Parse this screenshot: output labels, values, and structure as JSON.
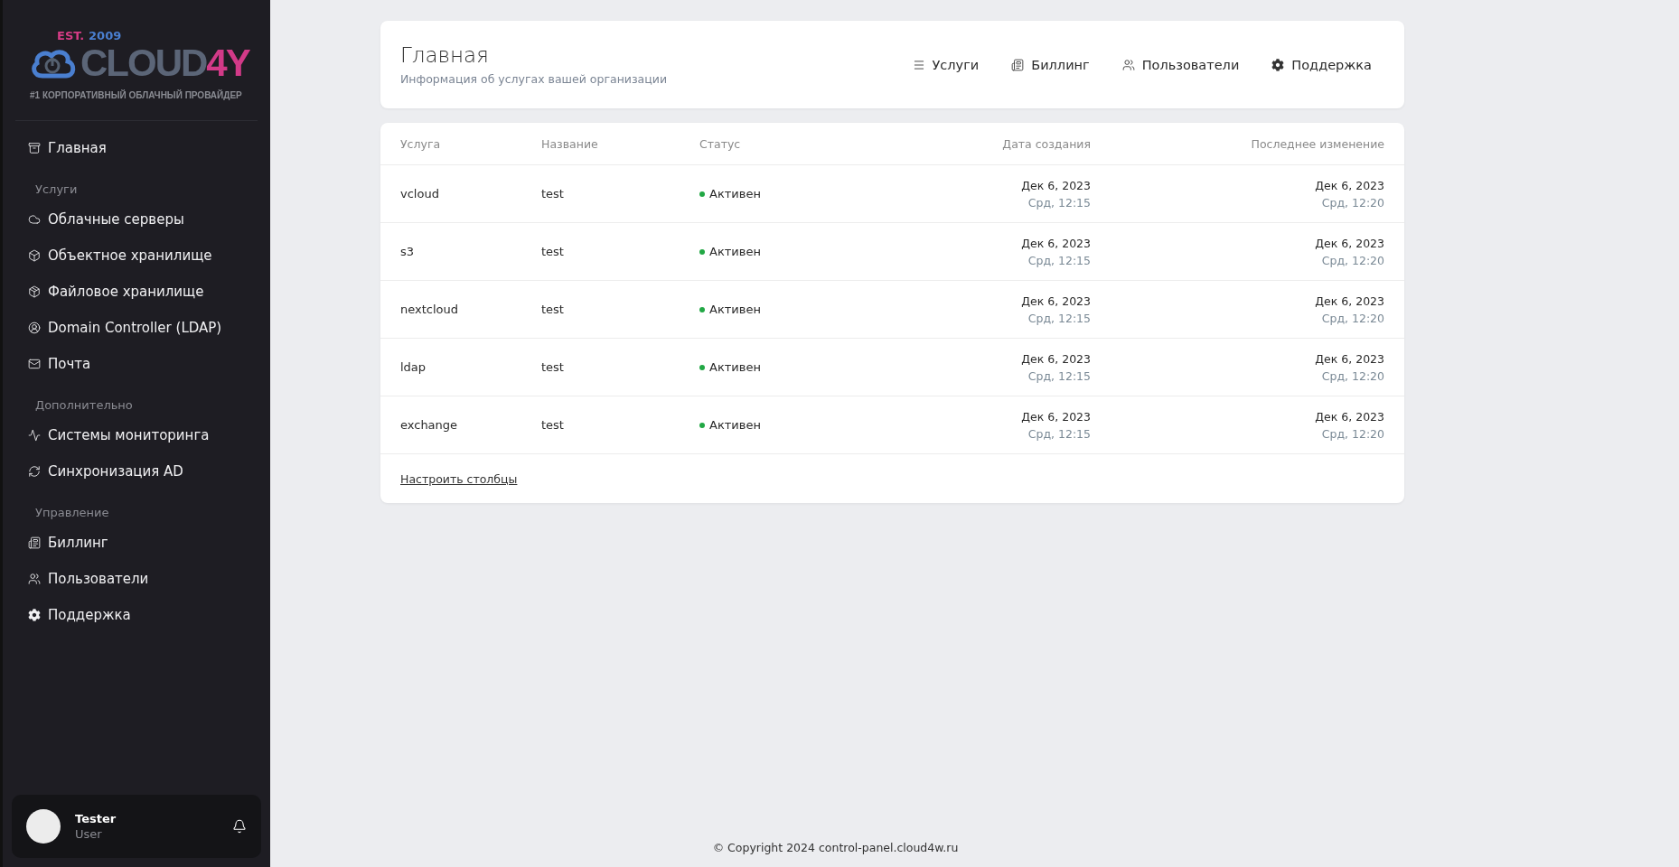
{
  "logo": {
    "est": "EST.",
    "year": "2009",
    "brand": "CLOUD",
    "brand_accent": "4Y",
    "tagline": "#1 КОРПОРАТИВНЫЙ ОБЛАЧНЫЙ ПРОВАЙДЕР"
  },
  "sidebar": {
    "sections": [
      {
        "items": [
          "Главная"
        ]
      },
      {
        "heading": "Услуги",
        "items": [
          "Облачные серверы",
          "Объектное хранилище",
          "Файловое хранилище",
          "Domain Controller (LDAP)",
          "Почта"
        ]
      },
      {
        "heading": "Дополнительно",
        "items": [
          "Системы мониторинга",
          "Синхронизация AD"
        ]
      },
      {
        "heading": "Управление",
        "items": [
          "Биллинг",
          "Пользователи",
          "Поддержка"
        ]
      }
    ],
    "user": {
      "name": "Tester",
      "role": "User"
    }
  },
  "header": {
    "title": "Главная",
    "subtitle": "Информация об услугах вашей организации",
    "nav": [
      "Услуги",
      "Биллинг",
      "Пользователи",
      "Поддержка"
    ]
  },
  "table": {
    "columns": [
      "Услуга",
      "Название",
      "Статус",
      "Дата создания",
      "Последнее изменение"
    ],
    "rows": [
      {
        "service": "vcloud",
        "name": "test",
        "status": "Активен",
        "created_date": "Дек 6, 2023",
        "created_time": "Срд, 12:15",
        "modified_date": "Дек 6, 2023",
        "modified_time": "Срд, 12:20"
      },
      {
        "service": "s3",
        "name": "test",
        "status": "Активен",
        "created_date": "Дек 6, 2023",
        "created_time": "Срд, 12:15",
        "modified_date": "Дек 6, 2023",
        "modified_time": "Срд, 12:20"
      },
      {
        "service": "nextcloud",
        "name": "test",
        "status": "Активен",
        "created_date": "Дек 6, 2023",
        "created_time": "Срд, 12:15",
        "modified_date": "Дек 6, 2023",
        "modified_time": "Срд, 12:20"
      },
      {
        "service": "ldap",
        "name": "test",
        "status": "Активен",
        "created_date": "Дек 6, 2023",
        "created_time": "Срд, 12:15",
        "modified_date": "Дек 6, 2023",
        "modified_time": "Срд, 12:20"
      },
      {
        "service": "exchange",
        "name": "test",
        "status": "Активен",
        "created_date": "Дек 6, 2023",
        "created_time": "Срд, 12:15",
        "modified_date": "Дек 6, 2023",
        "modified_time": "Срд, 12:20"
      }
    ],
    "configure_link": "Настроить столбцы"
  },
  "footer": "© Copyright 2024 control-panel.cloud4w.ru"
}
